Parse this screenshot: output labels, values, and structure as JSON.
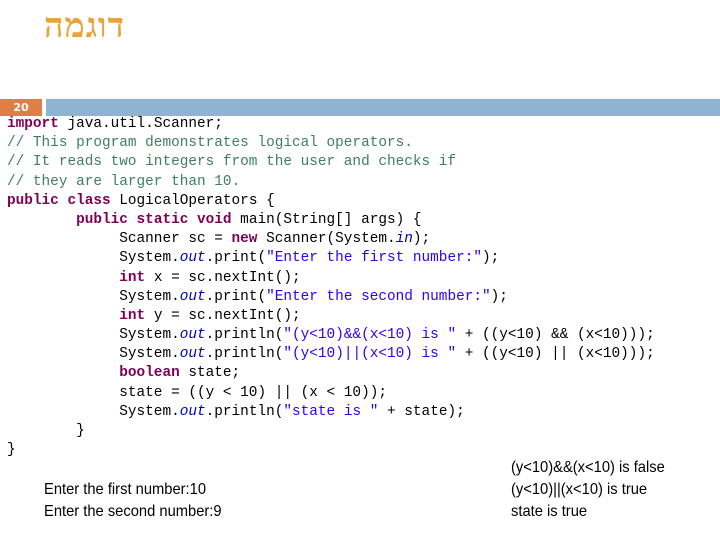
{
  "slide": {
    "title": "דוגמה",
    "number": "20",
    "colors": {
      "title": "#e8a33a",
      "number_badge": "#e07e47",
      "header_bar": "#8fb3d3",
      "keyword": "#7f0055",
      "comment": "#3f7f5f",
      "string": "#2a00ff"
    }
  },
  "code": {
    "lines": [
      [
        {
          "t": "kw",
          "v": "import"
        },
        {
          "t": "",
          "v": " java.util.Scanner;"
        }
      ],
      [
        {
          "t": "cm",
          "v": "// This program demonstrates logical operators."
        }
      ],
      [
        {
          "t": "cm",
          "v": "// It reads two integers from the user and checks if"
        }
      ],
      [
        {
          "t": "cm",
          "v": "// they are larger than 10."
        }
      ],
      [
        {
          "t": "kw",
          "v": "public class"
        },
        {
          "t": "",
          "v": " LogicalOperators {"
        }
      ],
      [
        {
          "t": "",
          "v": "        "
        },
        {
          "t": "kw",
          "v": "public static void"
        },
        {
          "t": "",
          "v": " main(String[] args) {"
        }
      ],
      [
        {
          "t": "",
          "v": "             Scanner sc = "
        },
        {
          "t": "kw",
          "v": "new"
        },
        {
          "t": "",
          "v": " Scanner(System."
        },
        {
          "t": "it",
          "v": "in"
        },
        {
          "t": "",
          "v": ");"
        }
      ],
      [
        {
          "t": "",
          "v": "             System."
        },
        {
          "t": "it",
          "v": "out"
        },
        {
          "t": "",
          "v": ".print("
        },
        {
          "t": "str",
          "v": "\"Enter the first number:\""
        },
        {
          "t": "",
          "v": ");"
        }
      ],
      [
        {
          "t": "",
          "v": "             "
        },
        {
          "t": "kw",
          "v": "int"
        },
        {
          "t": "",
          "v": " x = sc.nextInt();"
        }
      ],
      [
        {
          "t": "",
          "v": "             System."
        },
        {
          "t": "it",
          "v": "out"
        },
        {
          "t": "",
          "v": ".print("
        },
        {
          "t": "str",
          "v": "\"Enter the second number:\""
        },
        {
          "t": "",
          "v": ");"
        }
      ],
      [
        {
          "t": "",
          "v": "             "
        },
        {
          "t": "kw",
          "v": "int"
        },
        {
          "t": "",
          "v": " y = sc.nextInt();"
        }
      ],
      [
        {
          "t": "",
          "v": "             System."
        },
        {
          "t": "it",
          "v": "out"
        },
        {
          "t": "",
          "v": ".println("
        },
        {
          "t": "str",
          "v": "\"(y<10)&&(x<10) is \""
        },
        {
          "t": "",
          "v": " + ((y<10) && (x<10)));"
        }
      ],
      [
        {
          "t": "",
          "v": "             System."
        },
        {
          "t": "it",
          "v": "out"
        },
        {
          "t": "",
          "v": ".println("
        },
        {
          "t": "str",
          "v": "\"(y<10)||(x<10) is \""
        },
        {
          "t": "",
          "v": " + ((y<10) || (x<10)));"
        }
      ],
      [
        {
          "t": "",
          "v": "             "
        },
        {
          "t": "kw",
          "v": "boolean"
        },
        {
          "t": "",
          "v": " state;"
        }
      ],
      [
        {
          "t": "",
          "v": "             state = ((y < 10) || (x < 10));"
        }
      ],
      [
        {
          "t": "",
          "v": "             System."
        },
        {
          "t": "it",
          "v": "out"
        },
        {
          "t": "",
          "v": ".println("
        },
        {
          "t": "str",
          "v": "\"state is \""
        },
        {
          "t": "",
          "v": " + state);"
        }
      ],
      [
        {
          "t": "",
          "v": "        }"
        }
      ],
      [
        {
          "t": "",
          "v": "}"
        }
      ]
    ]
  },
  "output": {
    "input_lines": [
      "Enter the first number:10",
      "Enter the second number:9"
    ],
    "result_lines": [
      "(y<10)&&(x<10) is false",
      "(y<10)||(x<10) is true",
      "state is true"
    ]
  }
}
